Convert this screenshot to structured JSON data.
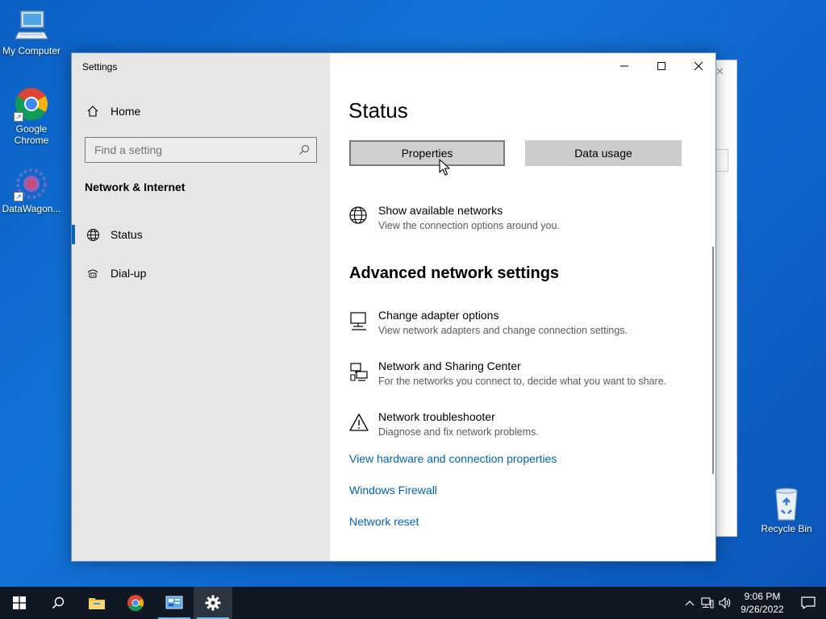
{
  "desktop": {
    "icons": [
      {
        "label": "My Computer",
        "icon": "computer-icon"
      },
      {
        "label": "Google Chrome",
        "icon": "chrome-icon"
      },
      {
        "label": "DataWagon...",
        "icon": "datawagon-icon"
      },
      {
        "label": "Recycle Bin",
        "icon": "recycle-bin-icon"
      }
    ]
  },
  "window": {
    "title": "Settings",
    "controls": {
      "minimize": "minimize-icon",
      "maximize": "maximize-icon",
      "close": "close-icon"
    }
  },
  "sidebar": {
    "home_label": "Home",
    "search_placeholder": "Find a setting",
    "section": "Network & Internet",
    "items": [
      {
        "label": "Status",
        "icon": "globe-icon",
        "active": true
      },
      {
        "label": "Dial-up",
        "icon": "dialup-icon",
        "active": false
      }
    ]
  },
  "content": {
    "title": "Status",
    "buttons": {
      "properties": "Properties",
      "data_usage": "Data usage"
    },
    "show_networks": {
      "title": "Show available networks",
      "subtitle": "View the connection options around you."
    },
    "advanced_heading": "Advanced network settings",
    "options": [
      {
        "title": "Change adapter options",
        "subtitle": "View network adapters and change connection settings.",
        "icon": "adapter-icon"
      },
      {
        "title": "Network and Sharing Center",
        "subtitle": "For the networks you connect to, decide what you want to share.",
        "icon": "sharing-center-icon"
      },
      {
        "title": "Network troubleshooter",
        "subtitle": "Diagnose and fix network problems.",
        "icon": "warning-icon"
      }
    ],
    "links": [
      "View hardware and connection properties",
      "Windows Firewall",
      "Network reset"
    ]
  },
  "taskbar": {
    "clock_time": "9:06 PM",
    "clock_date": "9/26/2022"
  },
  "colors": {
    "accent": "#0067c0",
    "link": "#0063b1",
    "taskbar": "#101823"
  }
}
